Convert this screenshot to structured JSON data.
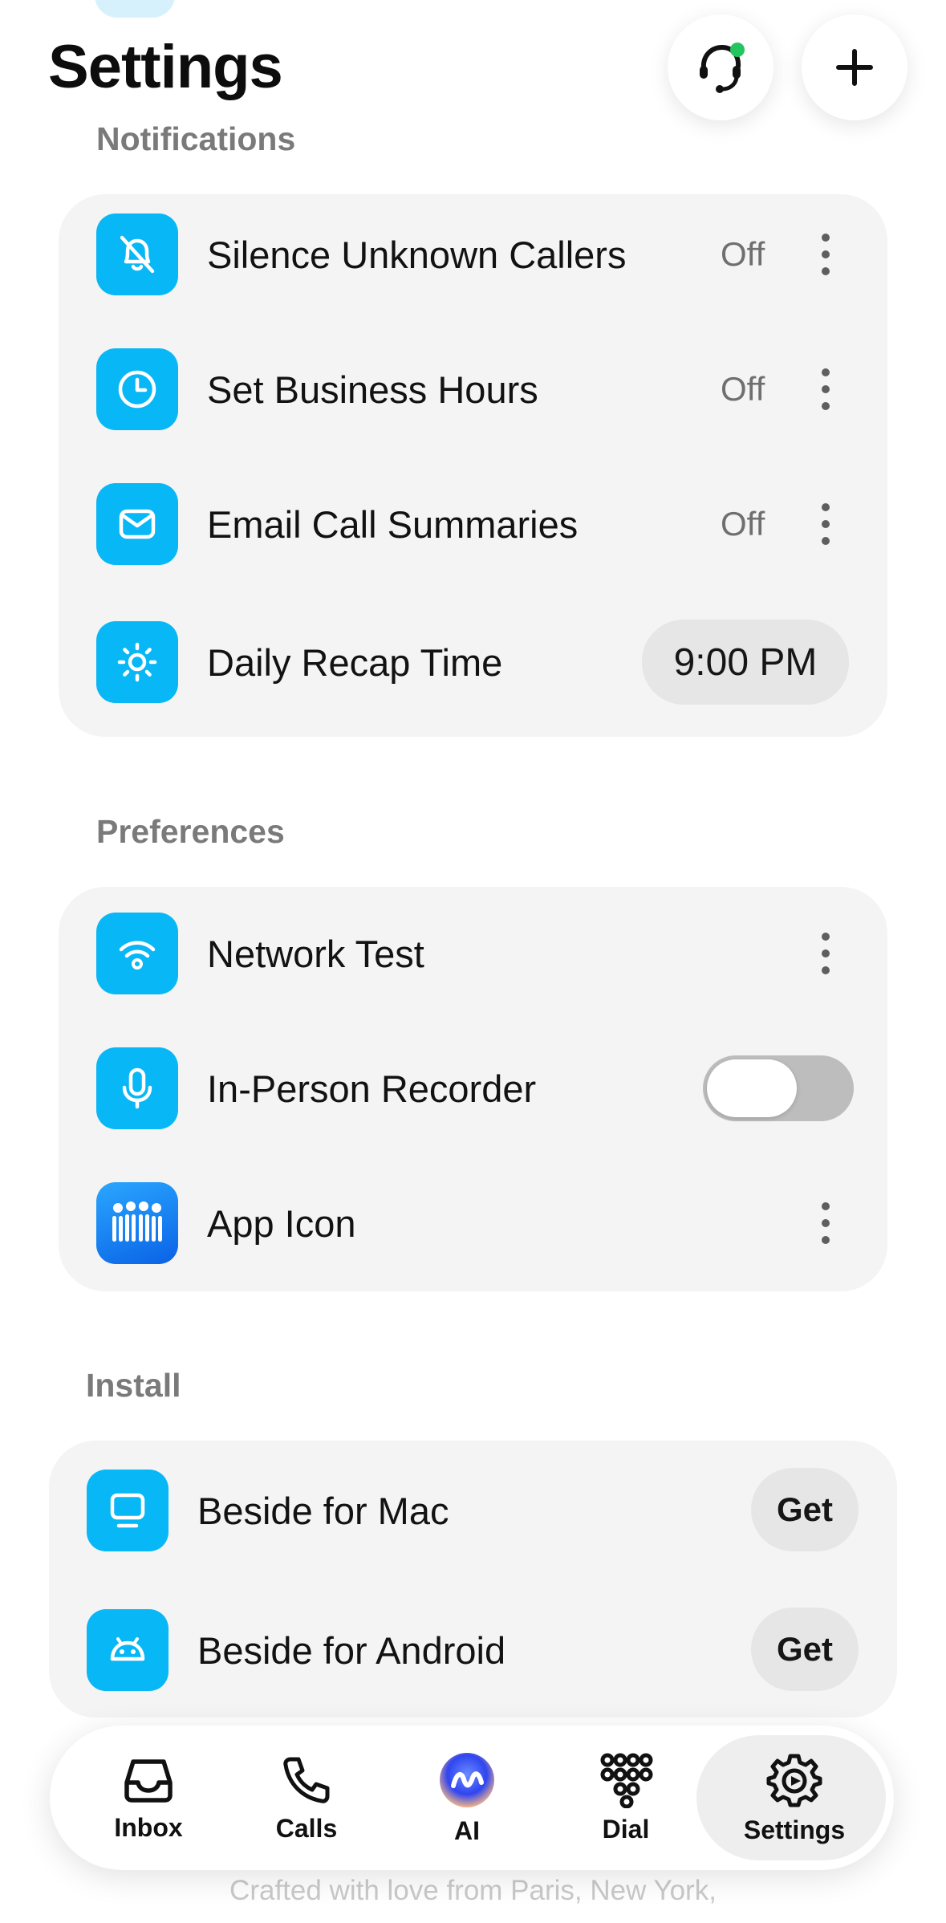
{
  "header": {
    "title": "Settings"
  },
  "sections": {
    "notifications": {
      "label": "Notifications",
      "items": [
        {
          "label": "Silence Unknown Callers",
          "value": "Off",
          "icon": "bell-slash-icon"
        },
        {
          "label": "Set Business Hours",
          "value": "Off",
          "icon": "clock-icon"
        },
        {
          "label": "Email Call Summaries",
          "value": "Off",
          "icon": "mail-icon"
        },
        {
          "label": "Daily Recap Time",
          "value": "9:00 PM",
          "icon": "sun-icon"
        }
      ]
    },
    "preferences": {
      "label": "Preferences",
      "items": [
        {
          "label": "Network Test",
          "icon": "wifi-icon"
        },
        {
          "label": "In-Person Recorder",
          "icon": "microphone-icon",
          "toggle_on": false
        },
        {
          "label": "App Icon",
          "icon": "app-icon"
        }
      ]
    },
    "install": {
      "label": "Install",
      "items": [
        {
          "label": "Beside for Mac",
          "button": "Get",
          "icon": "desktop-icon"
        },
        {
          "label": "Beside for Android",
          "button": "Get",
          "icon": "android-icon"
        }
      ]
    }
  },
  "tabbar": {
    "tabs": [
      {
        "label": "Inbox",
        "icon": "inbox-icon"
      },
      {
        "label": "Calls",
        "icon": "phone-icon"
      },
      {
        "label": "AI",
        "icon": "ai-orb-icon"
      },
      {
        "label": "Dial",
        "icon": "dialpad-icon"
      },
      {
        "label": "Settings",
        "icon": "gear-icon",
        "active": true
      }
    ]
  },
  "footer": {
    "text": "Crafted with love from Paris, New York,"
  },
  "colors": {
    "accent": "#08b7f5",
    "status_dot": "#22c55e"
  }
}
